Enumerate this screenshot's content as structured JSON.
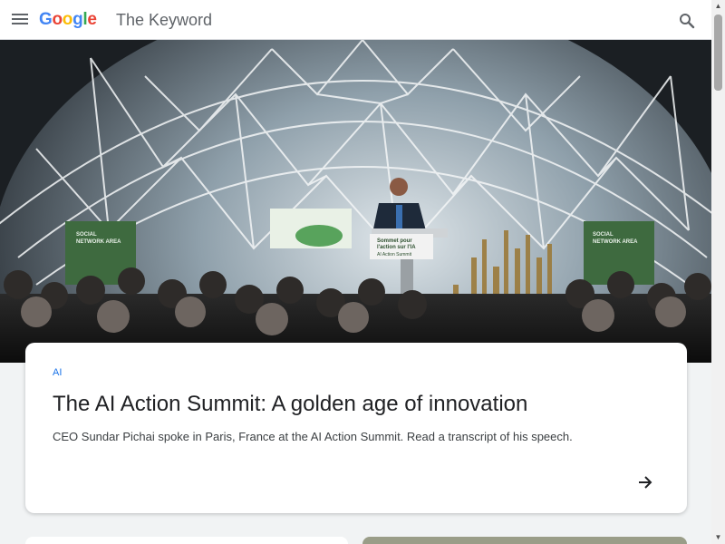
{
  "header": {
    "logo": [
      "G",
      "o",
      "o",
      "g",
      "l",
      "e"
    ],
    "title": "The Keyword",
    "menu_icon": "hamburger-menu-icon",
    "search_icon": "search-icon"
  },
  "hero": {
    "image": "Speaker at a podium inside a geodesic dome at the AI Action Summit",
    "podium_sign": [
      "Sommet pour",
      "l'action sur l'IA",
      "AI Action Summit"
    ],
    "left_sign": [
      "SOCIAL",
      "NETWORK AREA"
    ],
    "right_sign": [
      "SOCIAL",
      "NETWORK AREA"
    ]
  },
  "card": {
    "tag": "AI",
    "title": "The AI Action Summit: A golden age of innovation",
    "description": "CEO Sundar Pichai spoke in Paris, France at the AI Action Summit. Read a transcript of his speech.",
    "arrow_icon": "arrow-right-icon"
  },
  "colors": {
    "accent": "#1a73e8",
    "title_text": "#202124",
    "body_text": "#3c4043",
    "page_bg": "#f1f3f4"
  }
}
